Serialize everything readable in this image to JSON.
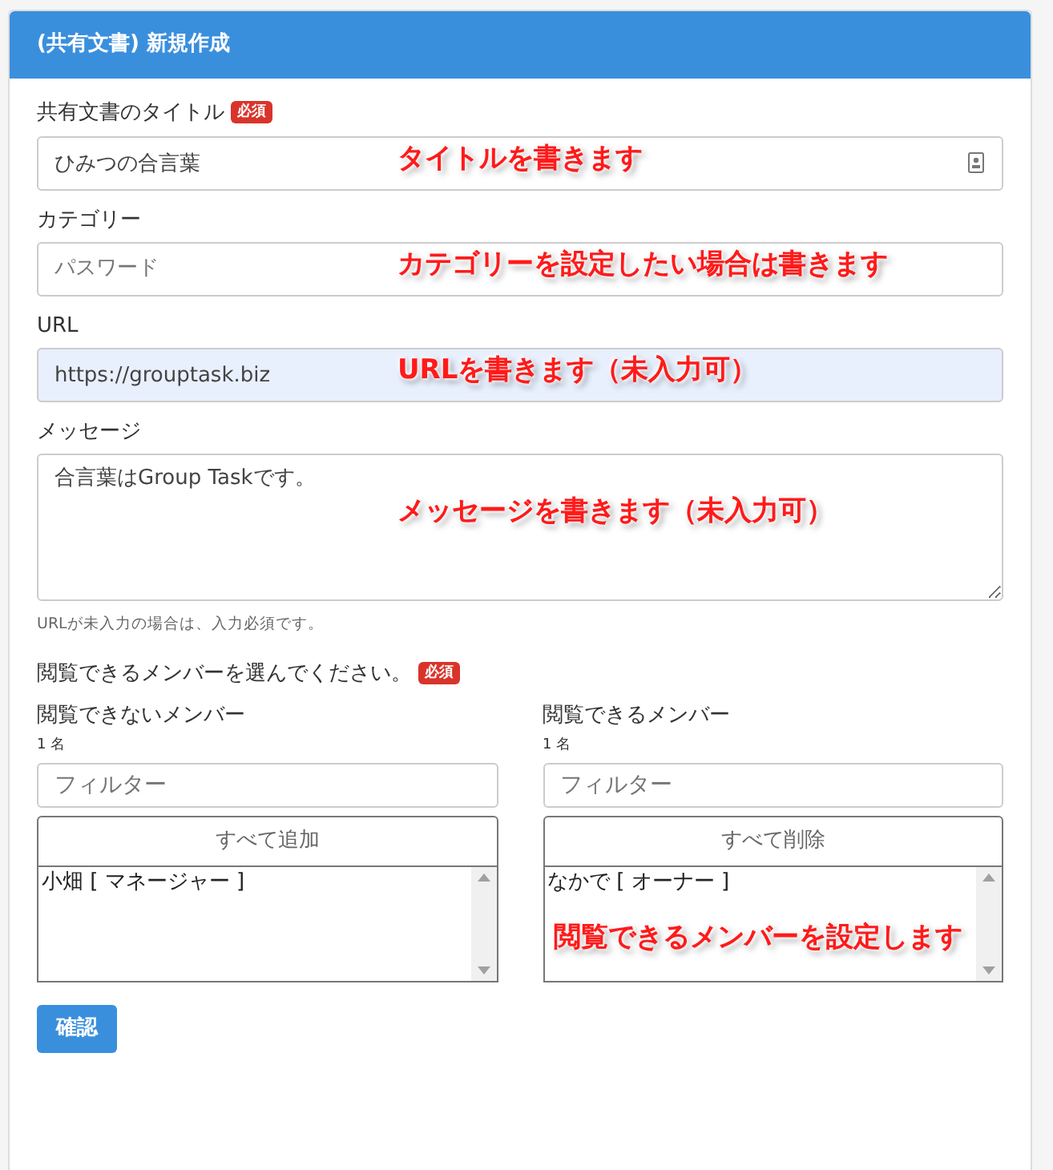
{
  "header": {
    "title": "(共有文書) 新規作成"
  },
  "fields": [
    {
      "kind": "input",
      "label": "共有文書のタイトル",
      "badge": "必須",
      "value": "ひみつの合言葉",
      "autofilled": false,
      "manager_icon": true,
      "annotation": "タイトルを書きます"
    },
    {
      "kind": "input",
      "label": "カテゴリー",
      "placeholder": "パスワード",
      "autofilled": false,
      "annotation": "カテゴリーを設定したい場合は書きます"
    },
    {
      "kind": "input",
      "label": "URL",
      "value": "https://grouptask.biz",
      "autofilled": true,
      "annotation": "URLを書きます（未入力可）"
    },
    {
      "kind": "textarea",
      "label": "メッセージ",
      "value": "合言葉はGroup Taskです。",
      "autofilled": false,
      "annotation": "メッセージを書きます（未入力可）",
      "help": "URLが未入力の場合は、入力必須です。"
    }
  ],
  "members": {
    "label": "閲覧できるメンバーを選んでください。",
    "badge": "必須",
    "columns": [
      {
        "heading": "閲覧できないメンバー",
        "count": "1 名",
        "filter_placeholder": "フィルター",
        "action": "すべて追加",
        "members": [
          "小畑 [ マネージャー ]"
        ]
      },
      {
        "heading": "閲覧できるメンバー",
        "count": "1 名",
        "filter_placeholder": "フィルター",
        "action": "すべて削除",
        "members": [
          "なかで [ オーナー ]"
        ],
        "annotation": "閲覧できるメンバーを設定します"
      }
    ]
  },
  "submit": "確認"
}
